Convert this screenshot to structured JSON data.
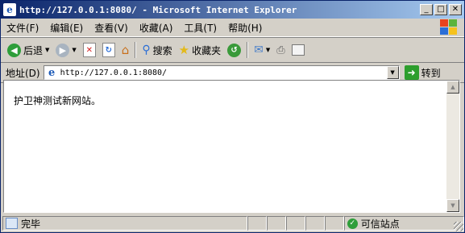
{
  "window": {
    "title": "http://127.0.0.1:8080/ - Microsoft Internet Explorer",
    "controls": {
      "minimize": "_",
      "maximize": "□",
      "close": "✕"
    }
  },
  "menu": [
    "文件(F)",
    "编辑(E)",
    "查看(V)",
    "收藏(A)",
    "工具(T)",
    "帮助(H)"
  ],
  "toolbar": {
    "back": "后退",
    "search": "搜索",
    "favorites": "收藏夹"
  },
  "address": {
    "label": "地址(D)",
    "url": "http://127.0.0.1:8080/",
    "go": "转到"
  },
  "page": {
    "text": "护卫神测试新网站。"
  },
  "status": {
    "text": "完毕",
    "zone": "可信站点"
  },
  "colors": {
    "titlebar_start": "#0a246a",
    "titlebar_end": "#a6caf0",
    "chrome": "#d4d0c8"
  }
}
